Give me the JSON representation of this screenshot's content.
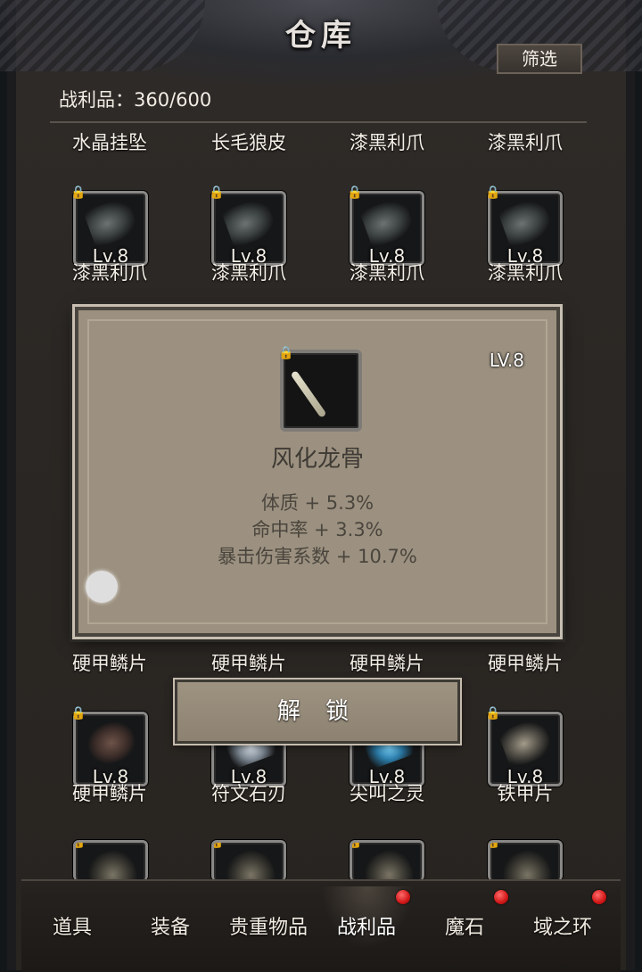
{
  "header": {
    "title": "仓库",
    "filter_label": "筛选"
  },
  "inventory": {
    "counter": "战利品：360/600"
  },
  "grid": {
    "row0_labels": [
      "水晶挂坠",
      "长毛狼皮",
      "漆黑利爪",
      "漆黑利爪"
    ],
    "row1": [
      {
        "level": "Lv.8",
        "name": "漆黑利爪"
      },
      {
        "level": "Lv.8",
        "name": "漆黑利爪"
      },
      {
        "level": "Lv.8",
        "name": "漆黑利爪"
      },
      {
        "level": "Lv.8",
        "name": "漆黑利爪"
      }
    ],
    "row3_labels": [
      "硬甲鳞片",
      "硬甲鳞片",
      "硬甲鳞片",
      "硬甲鳞片"
    ],
    "row4": [
      {
        "level": "Lv.8",
        "name": "硬甲鳞片"
      },
      {
        "level": "Lv.8",
        "name": "符文石刃"
      },
      {
        "level": "Lv.8",
        "name": "尖叫之灵"
      },
      {
        "level": "Lv.8",
        "name": "铁甲片"
      }
    ]
  },
  "popup": {
    "level": "LV.8",
    "name": "风化龙骨",
    "stats": [
      "体质 + 5.3%",
      "命中率 + 3.3%",
      "暴击伤害系数 + 10.7%"
    ],
    "unlock_label": "解 锁"
  },
  "tabs": [
    {
      "label": "道具",
      "badge": false
    },
    {
      "label": "装备",
      "badge": false
    },
    {
      "label": "贵重物品",
      "badge": false
    },
    {
      "label": "战利品",
      "badge": true,
      "active": true
    },
    {
      "label": "魔石",
      "badge": true
    },
    {
      "label": "域之环",
      "badge": true
    }
  ],
  "colors": {
    "badge": "#d01717",
    "panel": "#9c9180"
  }
}
